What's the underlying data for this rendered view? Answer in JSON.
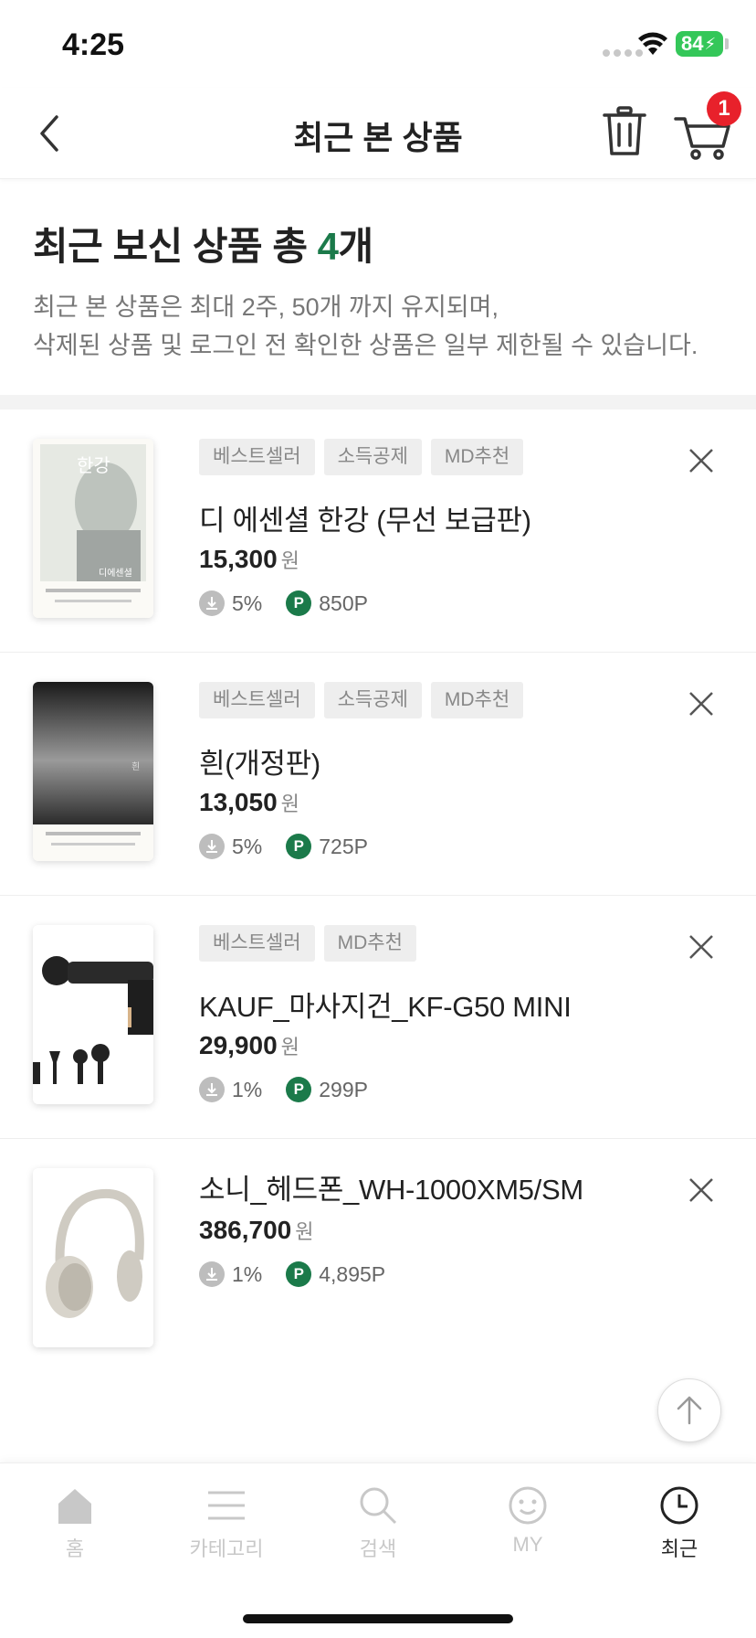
{
  "status": {
    "time": "4:25",
    "battery": "84"
  },
  "header": {
    "title": "최근 본 상품",
    "cart_count": "1"
  },
  "summary": {
    "heading_prefix": "최근 보신 상품 총 ",
    "count": "4",
    "heading_suffix": "개",
    "notice_line1": "최근 본 상품은 최대 2주, 50개 까지 유지되며,",
    "notice_line2": "삭제된 상품 및 로그인 전 확인한 상품은 일부 제한될 수 있습니다."
  },
  "products": [
    {
      "tags": [
        "베스트셀러",
        "소득공제",
        "MD추천"
      ],
      "name": "디 에센셜 한강 (무선 보급판)",
      "price": "15,300",
      "currency": "원",
      "discount": "5%",
      "points": "850P",
      "cover_title": "한강",
      "cover_sub": "디에센셜"
    },
    {
      "tags": [
        "베스트셀러",
        "소득공제",
        "MD추천"
      ],
      "name": "흰(개정판)",
      "price": "13,050",
      "currency": "원",
      "discount": "5%",
      "points": "725P",
      "cover_title": "흰"
    },
    {
      "tags": [
        "베스트셀러",
        "MD추천"
      ],
      "name": "KAUF_마사지건_KF-G50 MINI",
      "price": "29,900",
      "currency": "원",
      "discount": "1%",
      "points": "299P"
    },
    {
      "tags": [],
      "name": "소니_헤드폰_WH-1000XM5/SM",
      "price": "386,700",
      "currency": "원",
      "discount": "1%",
      "points": "4,895P"
    }
  ],
  "nav": {
    "home": "홈",
    "category": "카테고리",
    "search": "검색",
    "my": "MY",
    "recent": "최근"
  },
  "colors": {
    "accent": "#1b7a4a",
    "badge": "#e8212b"
  }
}
